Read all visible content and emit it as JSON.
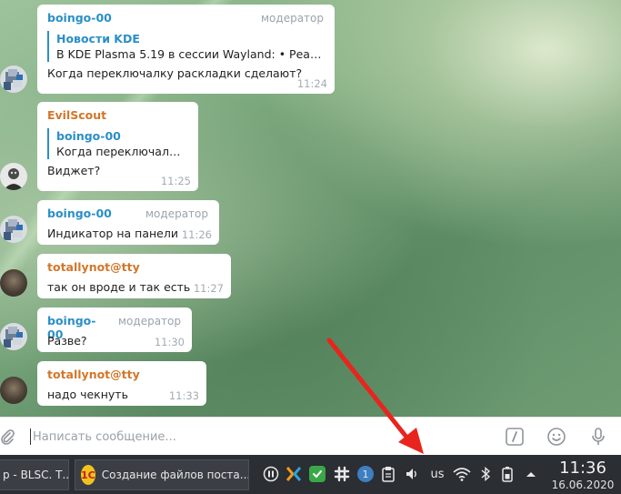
{
  "messages": [
    {
      "sender": "boingo-00",
      "role": "модератор",
      "reply_name": "Новости KDE",
      "reply_text": "В KDE Plasma 5.19 в сессии Wayland:  • Реали...",
      "text": "Когда переключалку раскладки сделают?",
      "time": "11:24"
    },
    {
      "sender": "EvilScout",
      "role": "",
      "reply_name": "boingo-00",
      "reply_text": "Когда переключалку...",
      "text": "Виджет?",
      "time": "11:25"
    },
    {
      "sender": "boingo-00",
      "role": "модератор",
      "text": "Индикатор на панели",
      "time": "11:26"
    },
    {
      "sender": "totallynot@tty",
      "role": "",
      "text": "так он вроде и так есть",
      "time": "11:27"
    },
    {
      "sender": "boingo-00",
      "role": "модератор",
      "text": "Разве?",
      "time": "11:30"
    },
    {
      "sender": "totallynot@tty",
      "role": "",
      "text": "надо чекнуть",
      "time": "11:33"
    }
  ],
  "composer": {
    "placeholder": "Написать сообщение..."
  },
  "taskbar": {
    "tasks": [
      {
        "label": "р - BLSC. Т..."
      },
      {
        "label": "Создание файлов поста..."
      }
    ],
    "tray": {
      "keyboard_layout": "us",
      "badge_count": "1"
    },
    "clock": {
      "time": "11:36",
      "date": "16.06.2020"
    }
  },
  "colors": {
    "link_blue": "#2a8fc7",
    "sender_orange": "#d2762a",
    "annotation_arrow": "#e8251d",
    "taskbar_bg": "#2b2e33"
  }
}
